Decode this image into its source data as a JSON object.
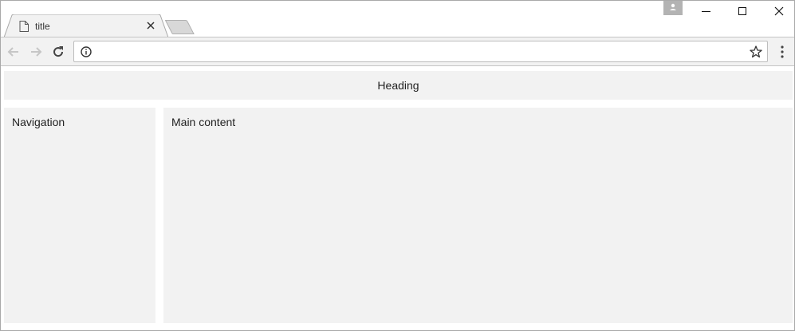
{
  "browser": {
    "tab": {
      "title": "title"
    },
    "address_bar": {
      "value": "",
      "placeholder": ""
    }
  },
  "page": {
    "heading": "Heading",
    "navigation": "Navigation",
    "main_content": "Main content"
  },
  "icons": {
    "tab_page": "page-icon",
    "tab_close": "close-icon",
    "new_tab": "new-tab-icon",
    "profile": "person-icon",
    "minimize": "minimize-icon",
    "maximize": "maximize-icon",
    "close": "close-icon",
    "back": "arrow-left-icon",
    "forward": "arrow-right-icon",
    "reload": "reload-icon",
    "site_info": "info-icon",
    "bookmark": "star-icon",
    "menu": "vertical-dots-icon"
  },
  "colors": {
    "panel_background": "#f2f2f2",
    "toolbar_background": "#f2f2f2",
    "window_border": "#a9a9a9"
  }
}
